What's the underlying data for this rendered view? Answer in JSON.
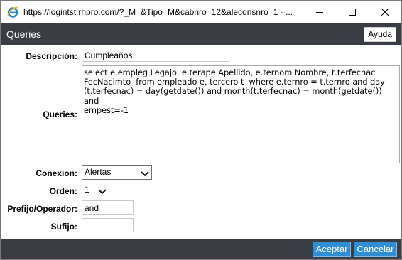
{
  "window": {
    "title": "https://logintst.rhpro.com/?_M=&Tipo=M&cabnro=12&aleconsnro=1 - ..."
  },
  "header": {
    "title": "Queries",
    "help_label": "Ayuda"
  },
  "form": {
    "descripcion": {
      "label": "Descripción:",
      "value": "Cumpleaños."
    },
    "queries": {
      "label": "Queries:",
      "value": "select e.empleg Legajo, e.terape Apellido, e.ternom Nombre, t.terfecnac\nFecNacimto  from empleado e, tercero t  where e.ternro = t.ternro and day\n(t.terfecnac) = day(getdate()) and month(t.terfecnac) = month(getdate()) and\nempest=-1"
    },
    "conexion": {
      "label": "Conexion:",
      "value": "Alertas"
    },
    "orden": {
      "label": "Orden:",
      "value": "1"
    },
    "prefijo": {
      "label": "Prefijo/Operador:",
      "value": "and"
    },
    "sufijo": {
      "label": "Sufijo:",
      "value": ""
    }
  },
  "footer": {
    "accept_label": "Aceptar",
    "cancel_label": "Cancelar"
  },
  "icons": {
    "browser": "ie-icon",
    "minimize": "minimize-icon",
    "maximize": "maximize-icon",
    "close": "close-icon",
    "dropdown": "chevron-down-icon"
  }
}
